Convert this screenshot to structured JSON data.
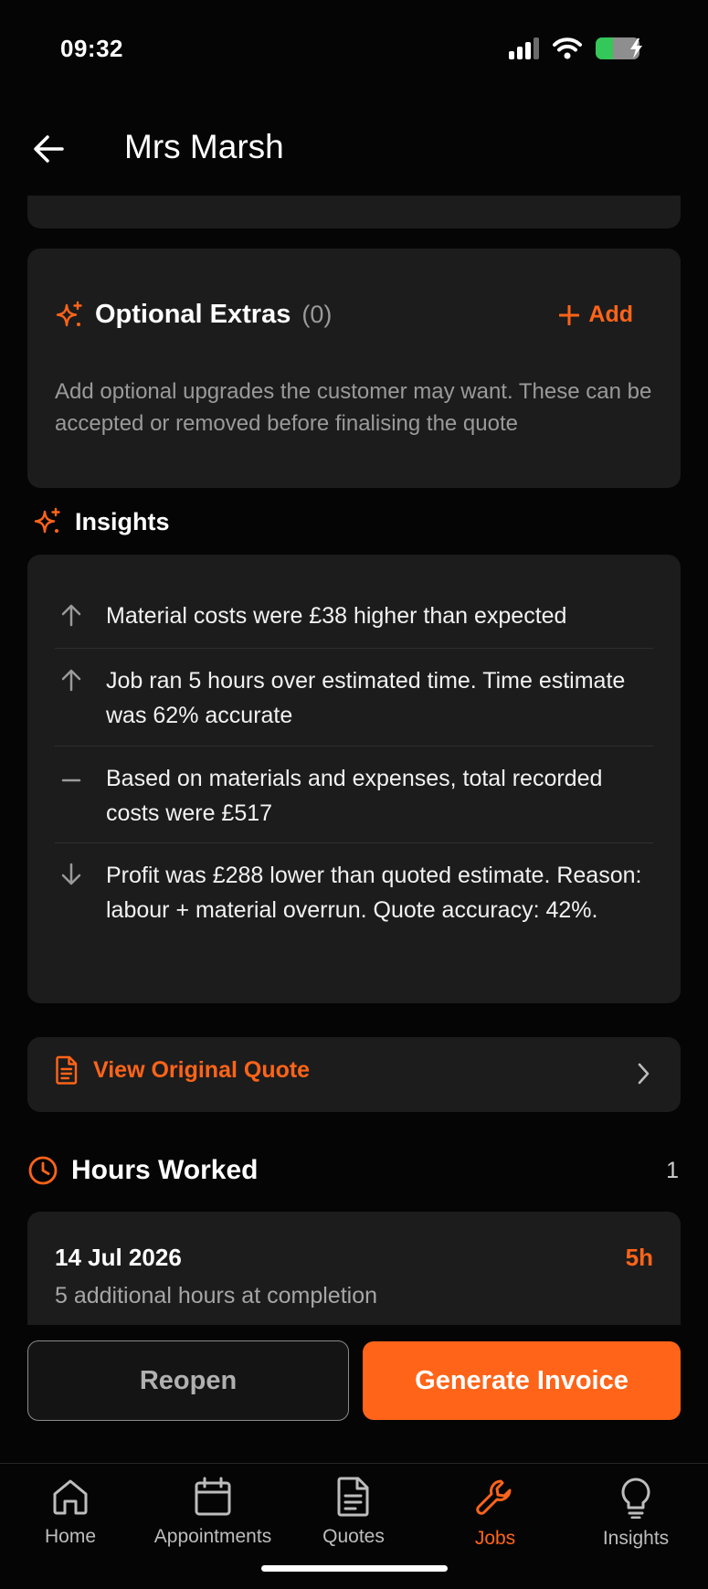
{
  "status_bar": {
    "time": "09:32"
  },
  "header": {
    "title": "Mrs Marsh"
  },
  "optional_extras": {
    "title": "Optional Extras",
    "count": "(0)",
    "add_label": "Add",
    "description": "Add optional upgrades the customer may want. These can be accepted or removed before finalising the quote"
  },
  "insights": {
    "heading": "Insights",
    "items": [
      {
        "trend": "up",
        "text": "Material costs were £38 higher than expected"
      },
      {
        "trend": "up",
        "text": "Job ran 5 hours over estimated time. Time estimate was 62% accurate"
      },
      {
        "trend": "neutral",
        "text": "Based on materials and expenses, total recorded costs were £517"
      },
      {
        "trend": "down",
        "text": "Profit was £288 lower than quoted estimate. Reason: labour + material overrun. Quote accuracy: 42%."
      }
    ]
  },
  "quote_link": {
    "label": "View Original Quote"
  },
  "hours_worked": {
    "title": "Hours Worked",
    "count": "1",
    "entries": [
      {
        "date": "14 Jul 2026",
        "hours": "5h",
        "note": "5 additional hours at completion"
      }
    ]
  },
  "actions": {
    "reopen_label": "Reopen",
    "invoice_label": "Generate Invoice"
  },
  "tabs": [
    {
      "label": "Home",
      "icon": "home-icon",
      "active": false
    },
    {
      "label": "Appointments",
      "icon": "calendar-icon",
      "active": false
    },
    {
      "label": "Quotes",
      "icon": "document-icon",
      "active": false
    },
    {
      "label": "Jobs",
      "icon": "wrench-icon",
      "active": true
    },
    {
      "label": "Insights",
      "icon": "lightbulb-icon",
      "active": false
    }
  ],
  "colors": {
    "accent": "#ff6419",
    "background": "#050505",
    "card": "#1c1c1c",
    "muted_text": "#9a9a9a"
  }
}
